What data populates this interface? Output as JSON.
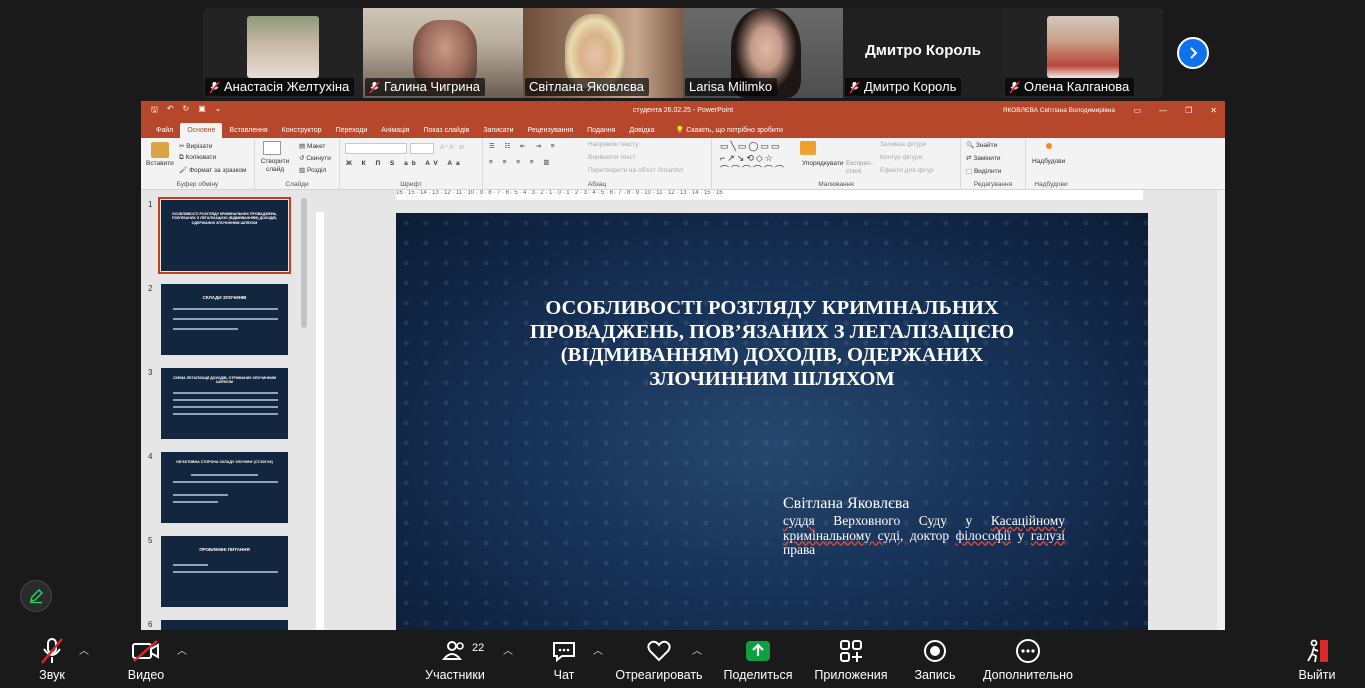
{
  "participants": [
    {
      "name": "Анастасія Желтухіна",
      "muted": true
    },
    {
      "name": "Галина Чигрина",
      "muted": true
    },
    {
      "name": "Світлана Яковлєва",
      "muted": false,
      "active": true
    },
    {
      "name": "Larisa Milimko",
      "muted": false
    },
    {
      "name": "Дмитро Король",
      "muted": true,
      "display_name": "Дмитро Король"
    },
    {
      "name": "Олена Калганова",
      "muted": true
    }
  ],
  "powerpoint": {
    "doc_title": "студента 26.02.25  -  PowerPoint",
    "user_name": "ЯКОВЛЄВА Світлана Володимирівна",
    "tabs": [
      "Файл",
      "Основне",
      "Вставлення",
      "Конструктор",
      "Переходи",
      "Анімація",
      "Показ слайдів",
      "Записати",
      "Рецензування",
      "Подання",
      "Довідка"
    ],
    "selected_tab": "Основне",
    "tell_me": "Скажіть, що потрібно зробити",
    "ribbon": {
      "clipboard": {
        "paste": "Вставити",
        "cut": "Вирізати",
        "copy": "Копіювати",
        "format": "Формат за зразком",
        "label": "Буфер обміну"
      },
      "slides": {
        "new": "Створити слайд",
        "layout": "Макет",
        "reset": "Скинути",
        "section": "Розділ",
        "label": "Слайди"
      },
      "font": {
        "label": "Шрифт"
      },
      "paragraph": {
        "direction": "Напрямок тексту",
        "align": "Вирівняти текст",
        "smartart": "Перетворити на об'єкт SmartArt",
        "label": "Абзац"
      },
      "drawing": {
        "arrange": "Упорядкувати",
        "styles": "Експрес-стилі",
        "fill": "Заливка фігури",
        "outline": "Контур фігури",
        "effects": "Ефекти для фігур",
        "label": "Малювання"
      },
      "editing": {
        "find": "Знайти",
        "replace": "Замінити",
        "select": "Виділити",
        "label": "Редагування"
      },
      "addins": {
        "button": "Надбудови",
        "label": "Надбудови"
      }
    },
    "ruler_ticks": "16 · 15 · 14 · 13 · 12 · 11 · 10 · 9 · 8 · 7 · 6 · 5 · 4 · 3 · 2 · 1 · 0 · 1 · 2 · 3 · 4 · 5 · 6 · 7 · 8 · 9 · 10 · 11 · 12 · 13 · 14 · 15 · 16",
    "thumbnails": [
      {
        "num": "1",
        "title": "ОСОБЛИВОСТІ РОЗГЛЯДУ КРИМІНАЛЬНИХ ПРОВАДЖЕНЬ, ПОВ'ЯЗАНИХ З ЛЕГАЛІЗАЦІЄЮ (ВІДМИВАННЯМ) ДОХОДІВ, ОДЕРЖАНИХ ЗЛОЧИННИМ ШЛЯХОМ"
      },
      {
        "num": "2",
        "title": "СКЛАДИ ЗЛОЧИНІВ"
      },
      {
        "num": "3",
        "title": "СХЕМА ЛЕГАЛІЗАЦІЇ ДОХОДІВ, ОТРИМАНИХ ЗЛОЧИННИМ ШЛЯХОМ"
      },
      {
        "num": "4",
        "title": "ОБ'ЄКТИВНА СТОРОНА СКЛАДУ ЗЛОЧИНУ (СТ.209 КК)"
      },
      {
        "num": "5",
        "title": "ПРОБЛЕМНІ ПИТАННЯ"
      },
      {
        "num": "6",
        "title": ""
      }
    ],
    "slide": {
      "title": "ОСОБЛИВОСТІ РОЗГЛЯДУ КРИМІНАЛЬНИХ ПРОВАДЖЕНЬ, ПОВ’ЯЗАНИХ З ЛЕГАЛІЗАЦІЄЮ (ВІДМИВАННЯМ) ДОХОДІВ, ОДЕРЖАНИХ ЗЛОЧИННИМ ШЛЯХОМ",
      "author": "Світлана Яковлєва",
      "subtitle_parts": [
        "суддя",
        " Верховного Суду у ",
        "Касаційному кримінальному суді",
        ", доктор ",
        "філософії",
        " у ",
        "галузі",
        " права"
      ]
    }
  },
  "toolbar": {
    "audio": "Звук",
    "video": "Видео",
    "participants": "Участники",
    "participants_count": "22",
    "chat": "Чат",
    "react": "Отреагировать",
    "share": "Поделиться",
    "apps": "Приложения",
    "record": "Запись",
    "more": "Дополнительно",
    "leave": "Выйти"
  },
  "colors": {
    "accent_green": "#23d959",
    "zoom_blue": "#0e72ed",
    "ppt_red": "#b7472a",
    "share_green": "#0e9f3f"
  }
}
